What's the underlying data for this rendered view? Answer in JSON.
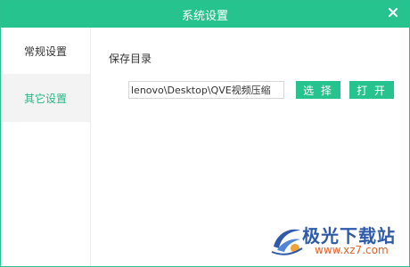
{
  "window": {
    "title": "系统设置"
  },
  "sidebar": {
    "items": [
      {
        "label": "常规设置",
        "active": false
      },
      {
        "label": "其它设置",
        "active": true
      }
    ]
  },
  "main": {
    "section_label": "保存目录",
    "path_value": "lenovo\\Desktop\\QVE视频压缩",
    "select_button": "选 择",
    "open_button": "打 开"
  },
  "watermark": {
    "title": "极光下载站",
    "url": "www.xz7.com"
  },
  "colors": {
    "accent": "#27c38f",
    "active_text": "#27b887",
    "watermark_blue": "#2e5aa8",
    "watermark_orange": "#e5622b"
  },
  "icons": {
    "close": "close-icon",
    "logo": "aurora-logo-icon"
  }
}
